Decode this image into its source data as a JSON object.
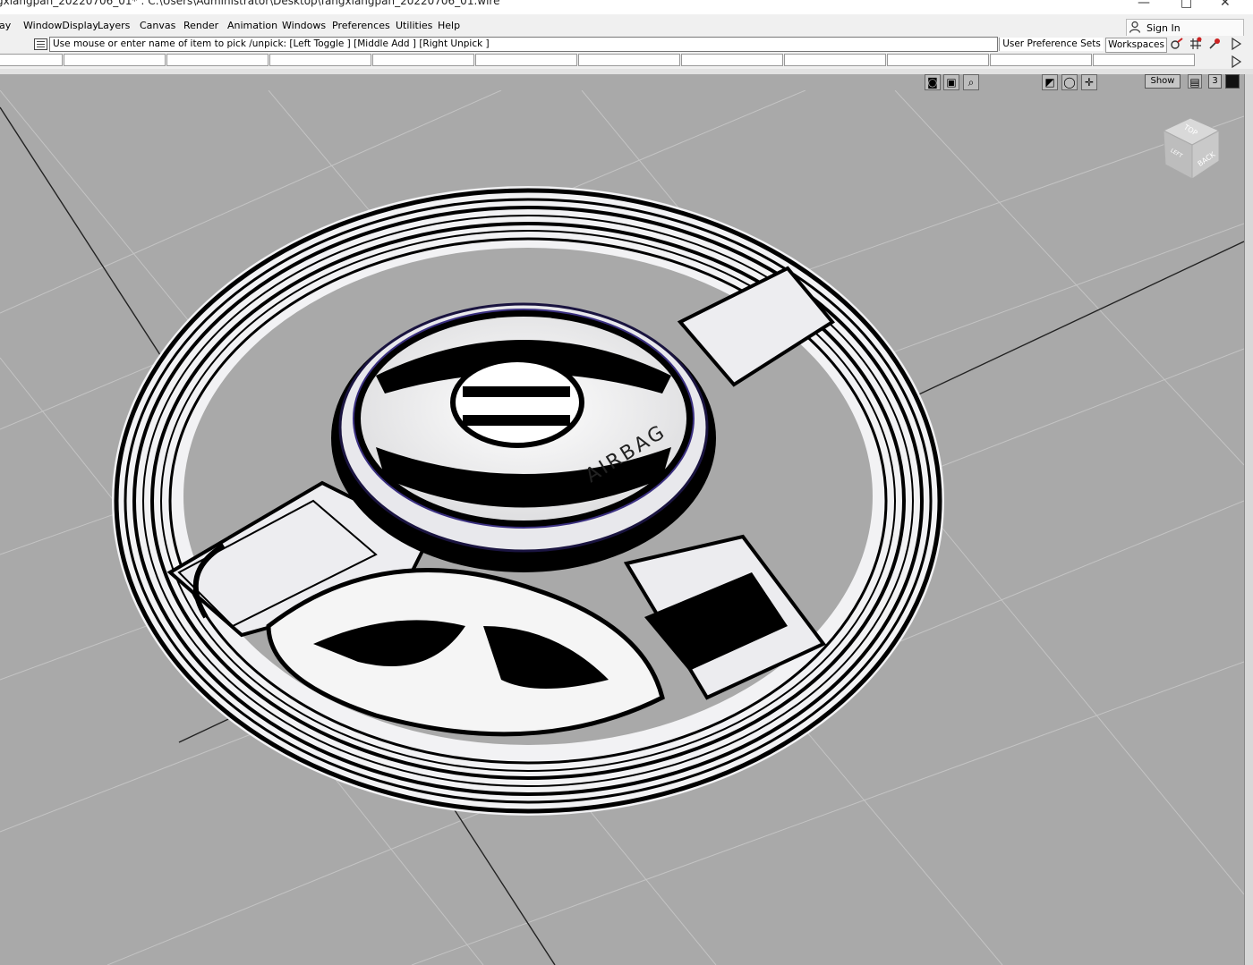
{
  "window": {
    "title": "gxiangpan_20220706_01* : C:\\Users\\Administrator\\Desktop\\fangxiangpan_20220706_01.wire",
    "controls": [
      "—",
      "□",
      "✕"
    ]
  },
  "menu": {
    "items": [
      "ay",
      "WindowDisplay",
      "Layers",
      "Canvas",
      "Render",
      "Animation",
      "Windows",
      "Preferences",
      "Utilities",
      "Help"
    ]
  },
  "signin": {
    "label": "Sign In",
    "icon": "user-icon"
  },
  "prompt": {
    "text": "Use mouse or enter name of item to pick /unpick: [Left Toggle ] [Middle Add ] [Right Unpick ]",
    "icon": "prompt-history-icon"
  },
  "toolbar": {
    "user_preference_sets": "User Preference Sets",
    "workspaces": "Workspaces",
    "icons": [
      "pick-tool-icon",
      "snap-tool-icon",
      "lock-tool-icon",
      "expand-arrow-icon"
    ]
  },
  "viewport": {
    "show_label": "Show",
    "layout_number": "3",
    "camera_icons": [
      "camera-icon",
      "film-icon",
      "zoom-icon",
      "shade-icon",
      "sphere-icon",
      "grid-snap-icon"
    ],
    "viewcube": {
      "top": "TOP",
      "back": "BACK",
      "left": "LEFT"
    },
    "model_label": "AIRBAG",
    "background_color": "#a9a9a9"
  }
}
